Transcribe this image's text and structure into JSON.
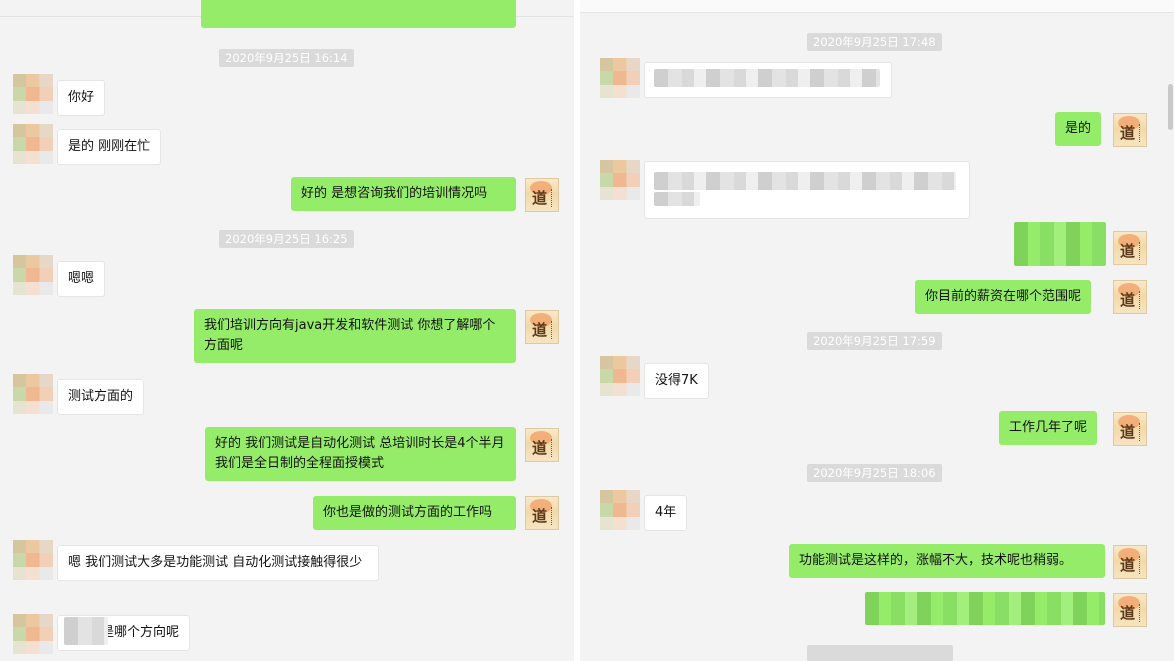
{
  "left": {
    "top_partial_text": "",
    "timestamps": [
      "2020年9月25日 16:14",
      "2020年9月25日 16:25"
    ],
    "messages": [
      "你好",
      "是的 刚刚在忙",
      "好的  是想咨询我们的培训情况吗",
      "嗯嗯",
      "我们培训方向有java开发和软件测试  你想了解哪个方面呢",
      "测试方面的",
      "好的  我们测试是自动化测试  总培训时长是4个半月  我们是全日制的全程面授模式",
      "你也是做的测试方面的工作吗",
      "嗯 我们测试大多是功能测试 自动化测试接触得很少",
      "的是哪个方向呢"
    ]
  },
  "right": {
    "timestamps": [
      "2020年9月25日 17:48",
      "2020年9月25日 17:59",
      "2020年9月25日 18:06"
    ],
    "messages": [
      "是的",
      "你目前的薪资在哪个范围呢",
      "没得7K",
      "工作几年了呢",
      "4年",
      "功能测试是这样的，涨幅不大，技术呢也稍弱。"
    ]
  },
  "colors": {
    "sent_bubble": "#95ec69",
    "received_bubble": "#ffffff",
    "background": "#f3f3f3",
    "timestamp_bg": "#dadada"
  },
  "icons": {
    "self_avatar": "calligraphy-avatar-icon",
    "other_avatar": "pixelated-avatar-icon"
  }
}
